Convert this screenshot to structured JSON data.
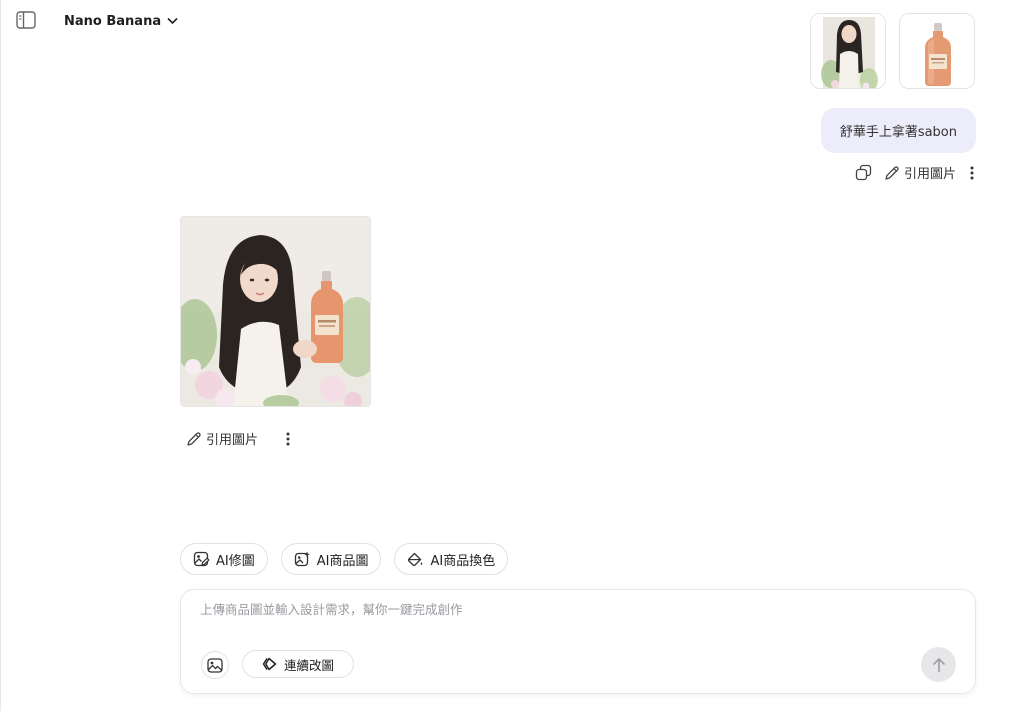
{
  "header": {
    "model_name": "Nano Banana",
    "sidebar_toggle_icon": "sidebar-panel-icon",
    "dropdown_icon": "chevron-down-icon"
  },
  "user_message": {
    "attachments": [
      {
        "name": "portrait-photo",
        "kind": "image"
      },
      {
        "name": "sabon-bottle-photo",
        "kind": "image"
      }
    ],
    "text": "舒華手上拿著sabon",
    "actions": {
      "copy_icon": "copy-icon",
      "reference_label": "引用圖片",
      "more_icon": "more-vertical-icon"
    }
  },
  "ai_response": {
    "image_name": "generated-portrait-with-bottle",
    "actions": {
      "reference_label": "引用圖片",
      "more_icon": "more-vertical-icon"
    }
  },
  "tools": [
    {
      "label": "AI修圖",
      "icon": "image-edit-icon"
    },
    {
      "label": "AI商品圖",
      "icon": "image-sparkle-icon"
    },
    {
      "label": "AI商品換色",
      "icon": "paint-bucket-icon"
    }
  ],
  "composer": {
    "placeholder": "上傳商品圖並輸入設計需求，幫你一鍵完成創作",
    "value": "",
    "continue_label": "連續改圖",
    "upload_icon": "image-upload-icon",
    "send_icon": "arrow-up-icon"
  },
  "colors": {
    "user_bubble": "#ececfb",
    "send_button": "#e7e7e9",
    "border": "#e1e1e4"
  }
}
